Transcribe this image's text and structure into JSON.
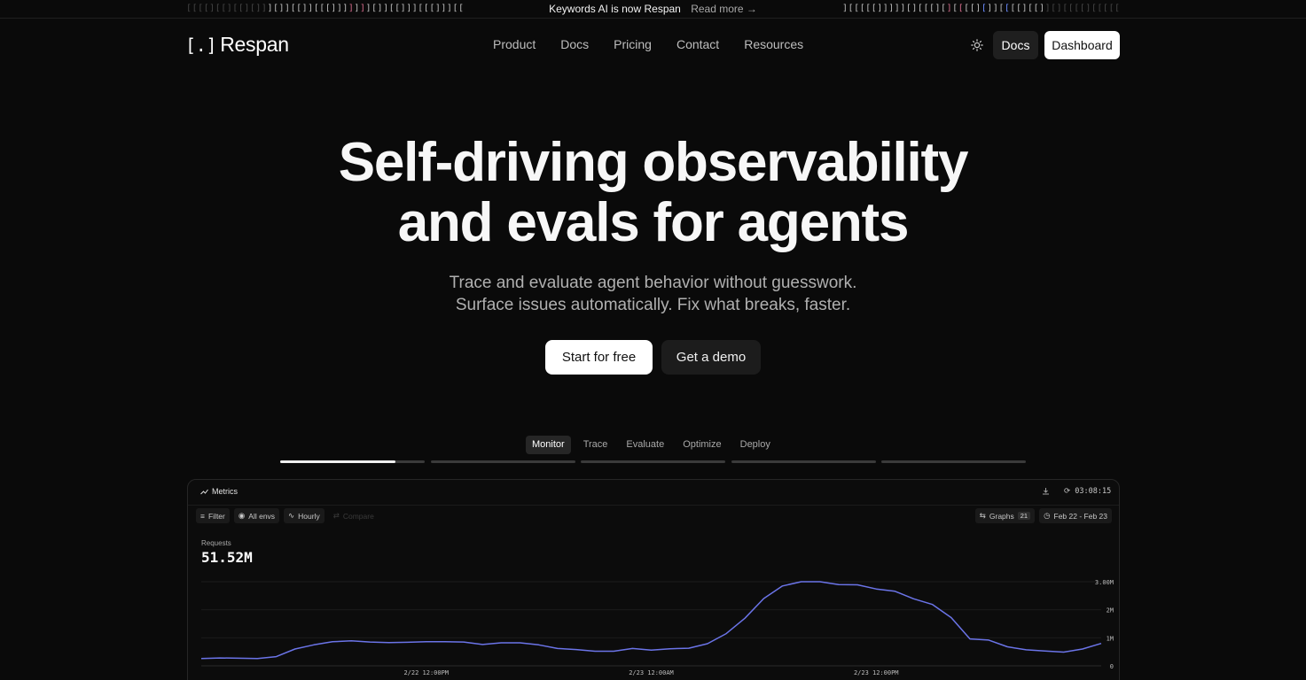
{
  "announcement": {
    "text": "Keywords AI is now Respan",
    "link": "Read more →",
    "brackets_left": "[[[[][[][[][]]][]][[]][[[]]]]]]][]][[]]][[[]]][[[[",
    "brackets_right": "][[[[[]]]]][][[[][][[[[][]][[[[][[]][][[[[][[[[[["
  },
  "nav": {
    "logo_mark": "[.]",
    "logo_text": "Respan",
    "links": [
      "Product",
      "Docs",
      "Pricing",
      "Contact",
      "Resources"
    ],
    "docs_button": "Docs",
    "dashboard_button": "Dashboard"
  },
  "hero": {
    "title_line1": "Self-driving observability",
    "title_line2": "and evals for agents",
    "subtitle_line1": "Trace and evaluate agent behavior without guesswork.",
    "subtitle_line2": "Surface issues automatically. Fix what breaks, faster.",
    "cta_primary": "Start for free",
    "cta_secondary": "Get a demo"
  },
  "tabs": {
    "items": [
      "Monitor",
      "Trace",
      "Evaluate",
      "Optimize",
      "Deploy"
    ],
    "active": "Monitor",
    "progress": [
      0.8,
      0,
      0,
      0,
      0
    ]
  },
  "dashboard": {
    "title": "Metrics",
    "time": "03:08:15",
    "filter": "Filter",
    "envs": "All envs",
    "interval": "Hourly",
    "compare": "Compare",
    "graphs_label": "Graphs",
    "graphs_count": "21",
    "date_range": "Feb 22 - Feb 23"
  },
  "chart_data": {
    "type": "line",
    "title": "Requests",
    "total": "51.52M",
    "y_ticks": [
      "0",
      "1M",
      "2M",
      "3.00M"
    ],
    "ylim": [
      0,
      3000000
    ],
    "x_ticks": [
      "2/22 12:00PM",
      "2/23 12:00AM",
      "2/23 12:00PM"
    ],
    "x_hours": [
      0,
      12,
      24
    ],
    "x_range_hours": [
      -12,
      36
    ],
    "series": [
      {
        "x_hours": [
          -12,
          -11,
          -10,
          -9,
          -8,
          -7,
          -6,
          -5,
          -4,
          -3,
          -2,
          -1,
          0,
          1,
          2,
          3,
          4,
          5,
          6,
          7,
          8,
          9,
          10,
          11,
          12,
          13,
          14,
          15,
          16,
          17,
          18,
          19,
          20,
          21,
          22,
          23,
          24,
          25,
          26,
          27,
          28,
          29,
          30,
          31,
          32,
          33,
          34,
          35,
          36
        ],
        "values": [
          260000,
          280000,
          270000,
          260000,
          330000,
          600000,
          750000,
          860000,
          890000,
          850000,
          830000,
          840000,
          860000,
          860000,
          850000,
          760000,
          820000,
          820000,
          750000,
          620000,
          580000,
          520000,
          520000,
          620000,
          560000,
          610000,
          630000,
          790000,
          1150000,
          1700000,
          2400000,
          2850000,
          3000000,
          3000000,
          2900000,
          2890000,
          2740000,
          2660000,
          2390000,
          2190000,
          1720000,
          960000,
          920000,
          680000,
          570000,
          530000,
          490000,
          600000,
          800000
        ]
      }
    ]
  }
}
